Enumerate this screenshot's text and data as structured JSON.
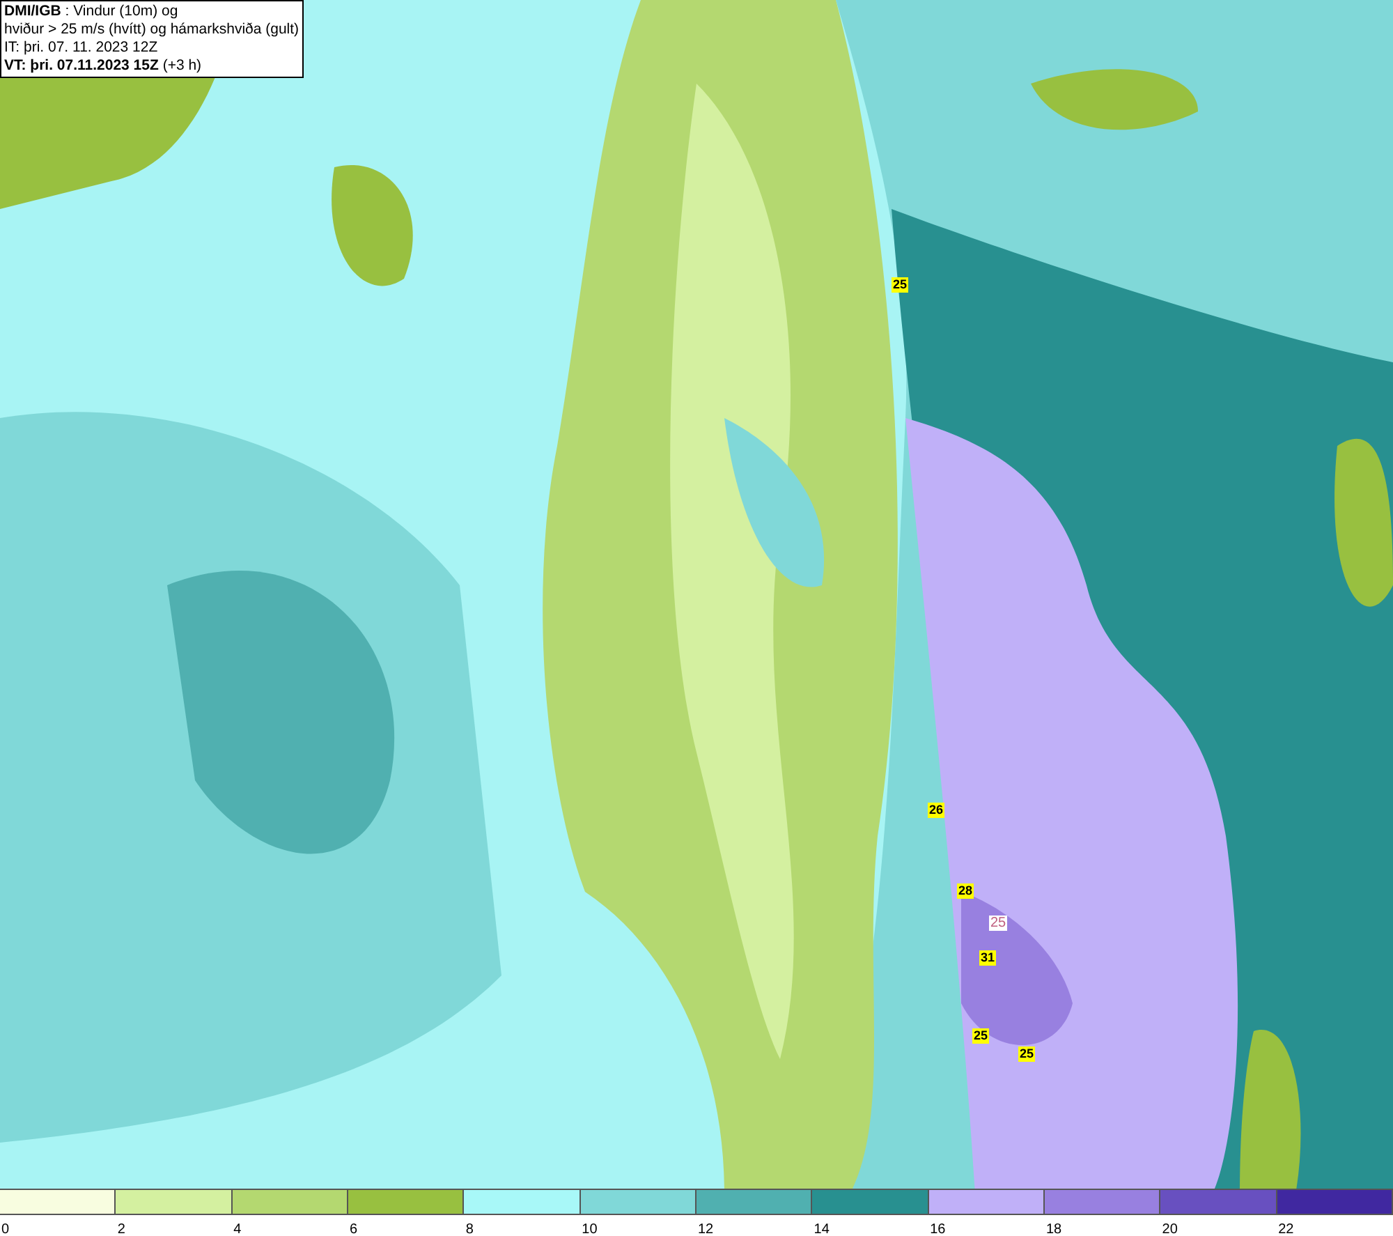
{
  "header": {
    "lines": [
      "**DMI/IGB** : Vindur (10m) og",
      "hviður > 25 m/s (hvítt) og hámarkshviða (gult)",
      "IT: þri. 07. 11. 2023 12Z",
      "**VT: þri. 07.11.2023 15Z** (+3 h)"
    ]
  },
  "map": {
    "gust_labels": [
      {
        "text": "25",
        "kind": "max"
      },
      {
        "text": "26",
        "kind": "max"
      },
      {
        "text": "28",
        "kind": "max"
      },
      {
        "text": "25",
        "kind": "contour"
      },
      {
        "text": "31",
        "kind": "max"
      },
      {
        "text": "25",
        "kind": "max"
      },
      {
        "text": "25",
        "kind": "max"
      }
    ]
  },
  "legend": {
    "segments": [
      {
        "label": "0",
        "color": "#f8fde0"
      },
      {
        "label": "2",
        "color": "#d4f0a0"
      },
      {
        "label": "4",
        "color": "#b4d870"
      },
      {
        "label": "6",
        "color": "#98c040"
      },
      {
        "label": "8",
        "color": "#a8f8f8"
      },
      {
        "label": "10",
        "color": "#80d8d8"
      },
      {
        "label": "12",
        "color": "#50b0b0"
      },
      {
        "label": "14",
        "color": "#289090"
      },
      {
        "label": "16",
        "color": "#c0b0f8"
      },
      {
        "label": "18",
        "color": "#9880e0"
      },
      {
        "label": "20",
        "color": "#6850c0"
      },
      {
        "label": "22",
        "color": "#4028a0"
      }
    ]
  }
}
